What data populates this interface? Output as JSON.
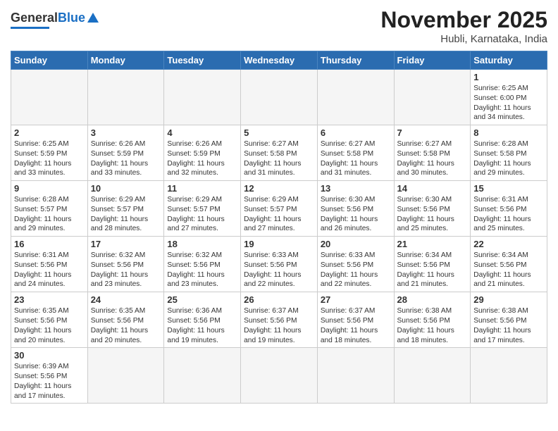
{
  "header": {
    "logo": {
      "general": "General",
      "blue": "Blue"
    },
    "title": "November 2025",
    "location": "Hubli, Karnataka, India"
  },
  "days_of_week": [
    "Sunday",
    "Monday",
    "Tuesday",
    "Wednesday",
    "Thursday",
    "Friday",
    "Saturday"
  ],
  "weeks": [
    [
      {
        "day": "",
        "info": ""
      },
      {
        "day": "",
        "info": ""
      },
      {
        "day": "",
        "info": ""
      },
      {
        "day": "",
        "info": ""
      },
      {
        "day": "",
        "info": ""
      },
      {
        "day": "",
        "info": ""
      },
      {
        "day": "1",
        "info": "Sunrise: 6:25 AM\nSunset: 6:00 PM\nDaylight: 11 hours\nand 34 minutes."
      }
    ],
    [
      {
        "day": "2",
        "info": "Sunrise: 6:25 AM\nSunset: 5:59 PM\nDaylight: 11 hours\nand 33 minutes."
      },
      {
        "day": "3",
        "info": "Sunrise: 6:26 AM\nSunset: 5:59 PM\nDaylight: 11 hours\nand 33 minutes."
      },
      {
        "day": "4",
        "info": "Sunrise: 6:26 AM\nSunset: 5:59 PM\nDaylight: 11 hours\nand 32 minutes."
      },
      {
        "day": "5",
        "info": "Sunrise: 6:27 AM\nSunset: 5:58 PM\nDaylight: 11 hours\nand 31 minutes."
      },
      {
        "day": "6",
        "info": "Sunrise: 6:27 AM\nSunset: 5:58 PM\nDaylight: 11 hours\nand 31 minutes."
      },
      {
        "day": "7",
        "info": "Sunrise: 6:27 AM\nSunset: 5:58 PM\nDaylight: 11 hours\nand 30 minutes."
      },
      {
        "day": "8",
        "info": "Sunrise: 6:28 AM\nSunset: 5:58 PM\nDaylight: 11 hours\nand 29 minutes."
      }
    ],
    [
      {
        "day": "9",
        "info": "Sunrise: 6:28 AM\nSunset: 5:57 PM\nDaylight: 11 hours\nand 29 minutes."
      },
      {
        "day": "10",
        "info": "Sunrise: 6:29 AM\nSunset: 5:57 PM\nDaylight: 11 hours\nand 28 minutes."
      },
      {
        "day": "11",
        "info": "Sunrise: 6:29 AM\nSunset: 5:57 PM\nDaylight: 11 hours\nand 27 minutes."
      },
      {
        "day": "12",
        "info": "Sunrise: 6:29 AM\nSunset: 5:57 PM\nDaylight: 11 hours\nand 27 minutes."
      },
      {
        "day": "13",
        "info": "Sunrise: 6:30 AM\nSunset: 5:56 PM\nDaylight: 11 hours\nand 26 minutes."
      },
      {
        "day": "14",
        "info": "Sunrise: 6:30 AM\nSunset: 5:56 PM\nDaylight: 11 hours\nand 25 minutes."
      },
      {
        "day": "15",
        "info": "Sunrise: 6:31 AM\nSunset: 5:56 PM\nDaylight: 11 hours\nand 25 minutes."
      }
    ],
    [
      {
        "day": "16",
        "info": "Sunrise: 6:31 AM\nSunset: 5:56 PM\nDaylight: 11 hours\nand 24 minutes."
      },
      {
        "day": "17",
        "info": "Sunrise: 6:32 AM\nSunset: 5:56 PM\nDaylight: 11 hours\nand 23 minutes."
      },
      {
        "day": "18",
        "info": "Sunrise: 6:32 AM\nSunset: 5:56 PM\nDaylight: 11 hours\nand 23 minutes."
      },
      {
        "day": "19",
        "info": "Sunrise: 6:33 AM\nSunset: 5:56 PM\nDaylight: 11 hours\nand 22 minutes."
      },
      {
        "day": "20",
        "info": "Sunrise: 6:33 AM\nSunset: 5:56 PM\nDaylight: 11 hours\nand 22 minutes."
      },
      {
        "day": "21",
        "info": "Sunrise: 6:34 AM\nSunset: 5:56 PM\nDaylight: 11 hours\nand 21 minutes."
      },
      {
        "day": "22",
        "info": "Sunrise: 6:34 AM\nSunset: 5:56 PM\nDaylight: 11 hours\nand 21 minutes."
      }
    ],
    [
      {
        "day": "23",
        "info": "Sunrise: 6:35 AM\nSunset: 5:56 PM\nDaylight: 11 hours\nand 20 minutes."
      },
      {
        "day": "24",
        "info": "Sunrise: 6:35 AM\nSunset: 5:56 PM\nDaylight: 11 hours\nand 20 minutes."
      },
      {
        "day": "25",
        "info": "Sunrise: 6:36 AM\nSunset: 5:56 PM\nDaylight: 11 hours\nand 19 minutes."
      },
      {
        "day": "26",
        "info": "Sunrise: 6:37 AM\nSunset: 5:56 PM\nDaylight: 11 hours\nand 19 minutes."
      },
      {
        "day": "27",
        "info": "Sunrise: 6:37 AM\nSunset: 5:56 PM\nDaylight: 11 hours\nand 18 minutes."
      },
      {
        "day": "28",
        "info": "Sunrise: 6:38 AM\nSunset: 5:56 PM\nDaylight: 11 hours\nand 18 minutes."
      },
      {
        "day": "29",
        "info": "Sunrise: 6:38 AM\nSunset: 5:56 PM\nDaylight: 11 hours\nand 17 minutes."
      }
    ],
    [
      {
        "day": "30",
        "info": "Sunrise: 6:39 AM\nSunset: 5:56 PM\nDaylight: 11 hours\nand 17 minutes."
      },
      {
        "day": "",
        "info": ""
      },
      {
        "day": "",
        "info": ""
      },
      {
        "day": "",
        "info": ""
      },
      {
        "day": "",
        "info": ""
      },
      {
        "day": "",
        "info": ""
      },
      {
        "day": "",
        "info": ""
      }
    ]
  ]
}
